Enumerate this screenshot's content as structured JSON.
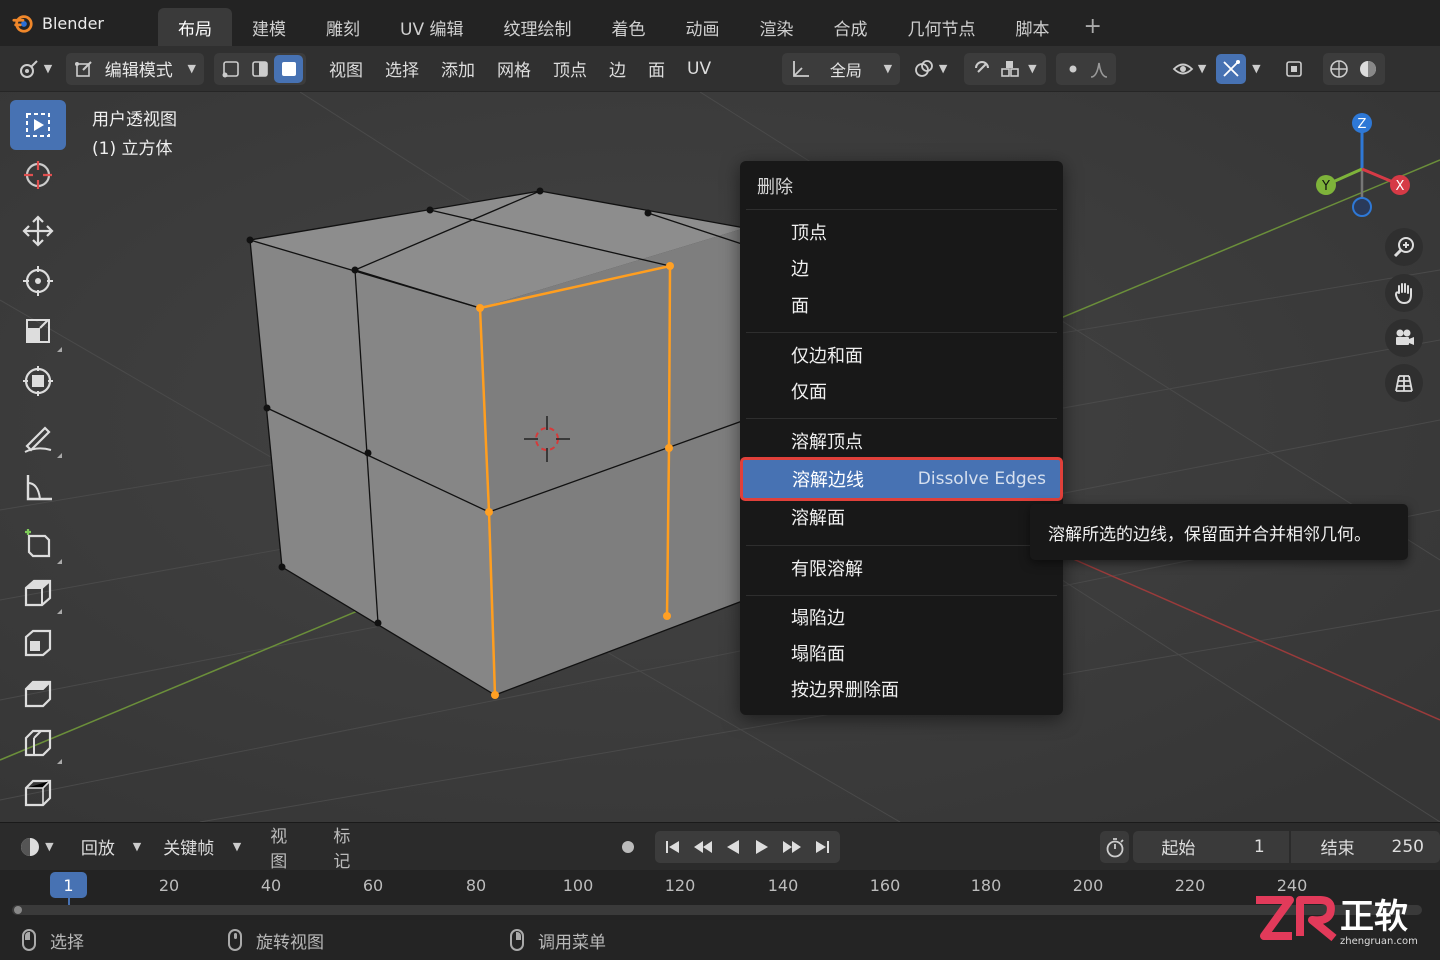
{
  "app": {
    "title": "Blender"
  },
  "workspace_tabs": [
    "布局",
    "建模",
    "雕刻",
    "UV 编辑",
    "纹理绘制",
    "着色",
    "动画",
    "渲染",
    "合成",
    "几何节点",
    "脚本"
  ],
  "header": {
    "mode": "编辑模式",
    "menus": [
      "视图",
      "选择",
      "添加",
      "网格",
      "顶点",
      "边",
      "面",
      "UV"
    ],
    "transform_orientation": "全局"
  },
  "viewport": {
    "view_name": "用户透视图",
    "object_name": "(1) 立方体",
    "gizmo_axes": {
      "z": "Z",
      "y": "Y",
      "x": "X"
    }
  },
  "context_menu": {
    "title": "删除",
    "groups": [
      [
        "顶点",
        "边",
        "面"
      ],
      [
        "仅边和面",
        "仅面"
      ],
      [
        "溶解顶点",
        "溶解边线",
        "溶解面"
      ],
      [
        "有限溶解"
      ],
      [
        "塌陷边",
        "塌陷面",
        "按边界删除面"
      ]
    ],
    "highlighted": {
      "label": "溶解边线",
      "english": "Dissolve Edges"
    }
  },
  "tooltip": "溶解所选的边线，保留面并合并相邻几何。",
  "timeline": {
    "playback": "回放",
    "keying": "关键帧",
    "view": "视图",
    "marker": "标记",
    "start_label": "起始",
    "start_value": "1",
    "end_label": "结束",
    "end_value": "250",
    "current_frame": "1",
    "ticks": [
      "20",
      "40",
      "60",
      "80",
      "100",
      "120",
      "140",
      "160",
      "180",
      "200",
      "220",
      "240"
    ]
  },
  "status": {
    "select": "选择",
    "rotate": "旋转视图",
    "menu": "调用菜单"
  },
  "watermark": {
    "brand": "正软",
    "domain": "zhengruan.com"
  },
  "colors": {
    "accent": "#4772b3",
    "selected_edge": "#ff9e1f",
    "highlight_border": "#e0403a"
  }
}
